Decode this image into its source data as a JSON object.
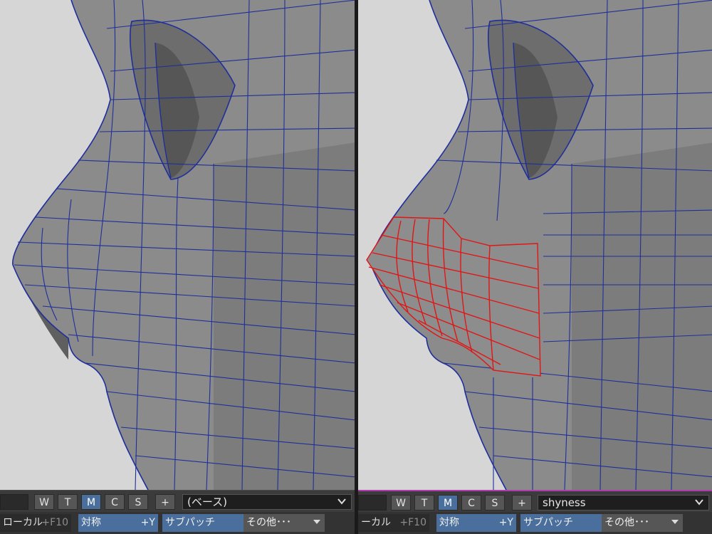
{
  "panes": [
    {
      "tabs": [
        "W",
        "T",
        "M",
        "C",
        "S"
      ],
      "active_tab": "M",
      "add_label": "+",
      "morph_target": "(ベース)",
      "local_label": "ローカル",
      "local_shortcut": "+F10",
      "symmetry_label": "対称",
      "symmetry_shortcut": "+Y",
      "subpatch_label": "サブパッチ",
      "other_label": "その他･･･"
    },
    {
      "tabs": [
        "W",
        "T",
        "M",
        "C",
        "S"
      ],
      "active_tab": "M",
      "add_label": "+",
      "morph_target": "shyness",
      "local_label": "ーカル",
      "local_shortcut": "+F10",
      "symmetry_label": "対称",
      "symmetry_shortcut": "+Y",
      "subpatch_label": "サブパッチ",
      "other_label": "その他･･･"
    }
  ],
  "colors": {
    "background": "#d6d6d6",
    "mesh_fill": "#8a8a8a",
    "wire": "#1f2f9a",
    "selection": "#e01616",
    "active_button": "#4b6f9c",
    "active_pane_border": "#b13ab1"
  }
}
